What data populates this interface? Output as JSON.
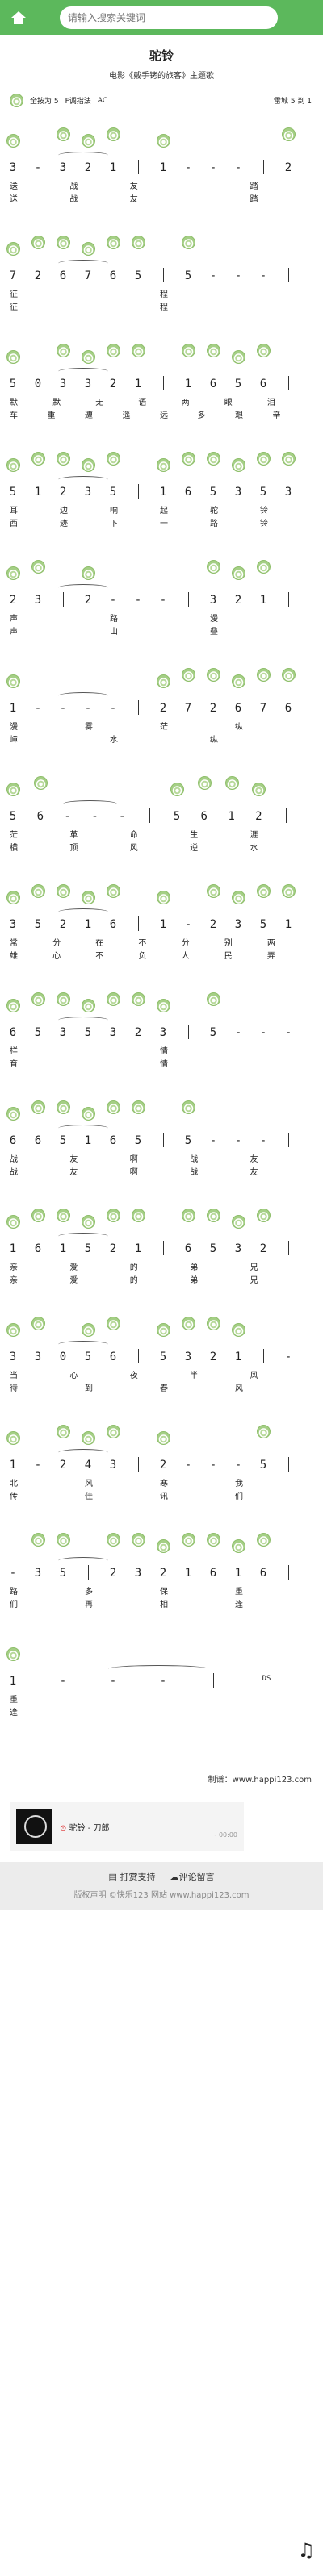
{
  "header": {
    "search_placeholder": "请输入搜索关键词",
    "colors": {
      "bar": "#5cb85c"
    }
  },
  "song": {
    "title": "驼铃",
    "subtitle": "电影《戴手铐的旅客》主题歌",
    "key": "全按为 5",
    "fingering": "F调指法",
    "type": "AC",
    "author_label": "雷城",
    "time_signature": "5 到 1"
  },
  "rows": [
    {
      "notes": [
        "3",
        "-",
        "3",
        "2",
        "1",
        "|",
        "1",
        "-",
        "-",
        "-",
        "|",
        "2"
      ],
      "lyrics": [
        "送",
        "战",
        "友",
        "",
        "踏"
      ],
      "lyrics2": [
        "送",
        "战",
        "友",
        "",
        "踏"
      ]
    },
    {
      "notes": [
        "7",
        "2",
        "6",
        "7",
        "6",
        "5",
        "|",
        "5",
        "-",
        "-",
        "-",
        "|"
      ],
      "lyrics": [
        "征",
        "程"
      ],
      "lyrics2": [
        "征",
        "程"
      ]
    },
    {
      "notes": [
        "5",
        "0",
        "3",
        "3",
        "2",
        "1",
        "|",
        "1",
        "6",
        "5",
        "6",
        "|"
      ],
      "lyrics": [
        "默",
        "默",
        "无",
        "语",
        "两",
        "眼",
        "泪"
      ],
      "lyrics2": [
        "车",
        "重",
        "遭",
        "遥",
        "远",
        "多",
        "艰",
        "辛"
      ]
    },
    {
      "notes": [
        "5",
        "1",
        "2",
        "3",
        "5",
        "|",
        "1",
        "6",
        "5",
        "3",
        "5",
        "3"
      ],
      "lyrics": [
        "耳",
        "边",
        "响",
        "起",
        "驼",
        "铃"
      ],
      "lyrics2": [
        "西",
        "迹",
        "下",
        "一",
        "路",
        "铃"
      ]
    },
    {
      "notes": [
        "2",
        "3",
        "|",
        "2",
        "-",
        "-",
        "-",
        "|",
        "3",
        "2",
        "1",
        "|"
      ],
      "lyrics": [
        "声",
        "路",
        "漫"
      ],
      "lyrics2": [
        "声",
        "山",
        "叠"
      ]
    },
    {
      "notes": [
        "1",
        "-",
        "-",
        "-",
        "-",
        "|",
        "2",
        "7",
        "2",
        "6",
        "7",
        "6"
      ],
      "lyrics": [
        "漫",
        "雾",
        "茫",
        "纵"
      ],
      "lyrics2": [
        "嶂",
        "水",
        "纵"
      ]
    },
    {
      "notes": [
        "5",
        "6",
        "-",
        "-",
        "-",
        "|",
        "5",
        "6",
        "1",
        "2",
        "|"
      ],
      "lyrics": [
        "茫",
        "革",
        "命",
        "生",
        "涯"
      ],
      "lyrics2": [
        "横",
        "顶",
        "风",
        "逆",
        "水"
      ]
    },
    {
      "notes": [
        "3",
        "5",
        "2",
        "1",
        "6",
        "|",
        "1",
        "-",
        "2",
        "3",
        "5",
        "1"
      ],
      "lyrics": [
        "常",
        "分",
        "在",
        "不",
        "分",
        "别",
        "两"
      ],
      "lyrics2": [
        "雄",
        "心",
        "不",
        "负",
        "人",
        "民",
        "弄"
      ]
    },
    {
      "notes": [
        "6",
        "5",
        "3",
        "5",
        "3",
        "2",
        "3",
        "|",
        "5",
        "-",
        "-",
        "-"
      ],
      "lyrics": [
        "样",
        "情"
      ],
      "lyrics2": [
        "育",
        "情"
      ]
    },
    {
      "notes": [
        "6",
        "6",
        "5",
        "1",
        "6",
        "5",
        "|",
        "5",
        "-",
        "-",
        "-",
        "|"
      ],
      "lyrics": [
        "战",
        "友",
        "啊",
        "战",
        "友"
      ],
      "lyrics2": [
        "战",
        "友",
        "啊",
        "战",
        "友"
      ]
    },
    {
      "notes": [
        "1",
        "6",
        "1",
        "5",
        "2",
        "1",
        "|",
        "6",
        "5",
        "3",
        "2",
        "|"
      ],
      "lyrics": [
        "亲",
        "爱",
        "的",
        "弟",
        "兄"
      ],
      "lyrics2": [
        "亲",
        "爱",
        "的",
        "弟",
        "兄"
      ]
    },
    {
      "notes": [
        "3",
        "3",
        "0",
        "5",
        "6",
        "|",
        "5",
        "3",
        "2",
        "1",
        "|",
        "-"
      ],
      "lyrics": [
        "当",
        "心",
        "夜",
        "半",
        "风"
      ],
      "lyrics2": [
        "待",
        "到",
        "春",
        "风"
      ]
    },
    {
      "notes": [
        "1",
        "-",
        "2",
        "4",
        "3",
        "|",
        "2",
        "-",
        "-",
        "-",
        "5",
        "|"
      ],
      "lyrics": [
        "北",
        "风",
        "寒",
        "我"
      ],
      "lyrics2": [
        "传",
        "佳",
        "讯",
        "们"
      ]
    },
    {
      "notes": [
        "-",
        "3",
        "5",
        "|",
        "2",
        "3",
        "2",
        "1",
        "6",
        "1",
        "6",
        "|"
      ],
      "lyrics": [
        "路",
        "多",
        "保",
        "重"
      ],
      "lyrics2": [
        "们",
        "再",
        "相",
        "逢"
      ]
    },
    {
      "notes": [
        "1",
        "-",
        "-",
        "-",
        "|",
        "DS"
      ],
      "lyrics": [
        "重"
      ],
      "lyrics2": [
        "逢"
      ]
    }
  ],
  "credit": "制谱：www.happi123.com",
  "player": {
    "title": "驼铃 - 刀郎",
    "time": "- 00:00"
  },
  "footer": {
    "support": "打赏支持",
    "comment": "评论留言",
    "copyright": "版权声明  ©快乐123 网站 www.happi123.com"
  }
}
